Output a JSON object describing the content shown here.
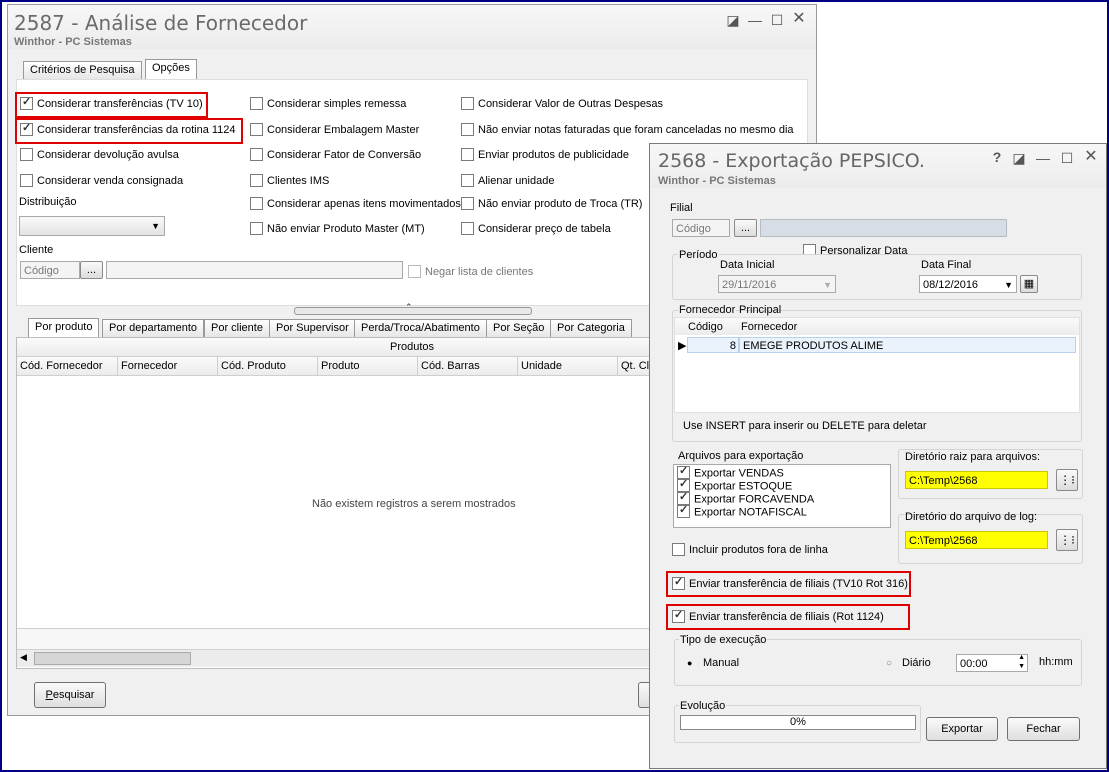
{
  "window1": {
    "title": "2587 - Análise de Fornecedor",
    "subtitle": "Winthor - PC Sistemas",
    "tabs": [
      "Critérios de Pesquisa",
      "Opções"
    ],
    "checkboxes_col1": [
      {
        "label": "Considerar transferências (TV 10)",
        "checked": true
      },
      {
        "label": "Considerar transferências da rotina 1124",
        "checked": true
      },
      {
        "label": "Considerar devolução avulsa",
        "checked": false
      },
      {
        "label": "Considerar venda consignada",
        "checked": false
      }
    ],
    "checkboxes_col2": [
      {
        "label": "Considerar simples remessa",
        "checked": false
      },
      {
        "label": "Considerar Embalagem Master",
        "checked": false
      },
      {
        "label": "Considerar Fator de Conversão",
        "checked": false
      },
      {
        "label": "Clientes IMS",
        "checked": false
      },
      {
        "label": "Considerar apenas itens movimentados",
        "checked": false
      },
      {
        "label": "Não enviar Produto Master (MT)",
        "checked": false
      }
    ],
    "checkboxes_col3": [
      {
        "label": "Considerar Valor de Outras Despesas",
        "checked": false
      },
      {
        "label": "Não enviar notas faturadas que foram canceladas no mesmo dia",
        "checked": false
      },
      {
        "label": "Enviar produtos de publicidade",
        "checked": false
      },
      {
        "label": "Alienar unidade",
        "checked": false
      },
      {
        "label": "Não enviar produto de Troca (TR)",
        "checked": false
      },
      {
        "label": "Considerar preço de tabela",
        "checked": false
      }
    ],
    "distribuicao_label": "Distribuição",
    "cliente_label": "Cliente",
    "cliente_placeholder": "Código",
    "ellipsis": "...",
    "negar_label": "Negar lista de clientes",
    "lower_tabs": [
      "Por produto",
      "Por departamento",
      "Por cliente",
      "Por Supervisor",
      "Perda/Troca/Abatimento",
      "Por Seção",
      "Por Categoria"
    ],
    "grid_group": "Produtos",
    "grid_columns": [
      "Cód. Fornecedor",
      "Fornecedor",
      "Cód. Produto",
      "Produto",
      "Cód. Barras",
      "Unidade",
      "Qt. Cli"
    ],
    "empty_message": "Não existem registros a serem mostrados",
    "pesquisar_label": "Pesquisar",
    "pesquisar_accel": "P"
  },
  "window2": {
    "title": "2568 - Exportação PEPSICO.",
    "subtitle": "Winthor - PC Sistemas",
    "help": "?",
    "filial_label": "Filial",
    "filial_placeholder": "Código",
    "ellipsis": "...",
    "personalizar_label": "Personalizar Data",
    "periodo_label": "Período",
    "data_inicial_label": "Data Inicial",
    "data_inicial_value": "29/11/2016",
    "data_final_label": "Data Final",
    "data_final_value": "08/12/2016",
    "fornecedor_group": "Fornecedor",
    "fornecedor_principal": "Principal",
    "fornecedor_cols": [
      "Código",
      "Fornecedor"
    ],
    "fornecedor_rows": [
      {
        "codigo": "8",
        "fornecedor": "EMEGE PRODUTOS ALIME"
      }
    ],
    "insert_hint": "Use INSERT para inserir ou DELETE para deletar",
    "arquivos_label": "Arquivos para exportação",
    "arquivos": [
      {
        "label": "Exportar VENDAS",
        "checked": true
      },
      {
        "label": "Exportar ESTOQUE",
        "checked": true
      },
      {
        "label": "Exportar FORCAVENDA",
        "checked": true
      },
      {
        "label": "Exportar NOTAFISCAL",
        "checked": true
      }
    ],
    "diretorio_raiz_label": "Diretório raiz para arquivos:",
    "diretorio_raiz_value": "C:\\Temp\\2568",
    "diretorio_log_label": "Diretório do arquivo de log:",
    "diretorio_log_value": "C:\\Temp\\2568",
    "incluir_label": "Incluir produtos fora de linha",
    "enviar1_label": "Enviar transferência de filiais (TV10 Rot 316)",
    "enviar2_label": "Enviar transferência de filiais (Rot 1124)",
    "tipo_label": "Tipo de execução",
    "manual_label": "Manual",
    "diario_label": "Diário",
    "time_value": "00:00",
    "hhmm": "hh:mm",
    "evolucao_label": "Evolução",
    "progress_text": "0%",
    "progress": 0,
    "exportar_label": "Exportar",
    "fechar_label": "Fechar"
  },
  "colors": {
    "highlight": "#e00000",
    "path_bg": "#ffff00",
    "outer_border": "#000080"
  }
}
